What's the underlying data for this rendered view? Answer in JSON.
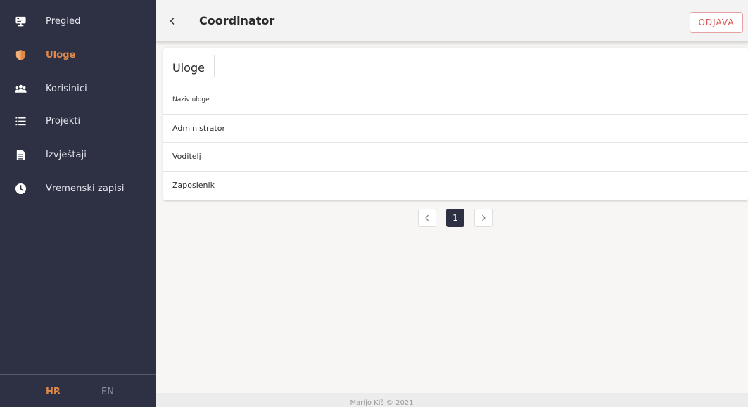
{
  "sidebar": {
    "items": [
      {
        "label": "Pregled",
        "icon": "monitor-icon"
      },
      {
        "label": "Uloge",
        "icon": "shield-icon",
        "active": true
      },
      {
        "label": "Korisinici",
        "icon": "users-icon"
      },
      {
        "label": "Projekti",
        "icon": "list-icon"
      },
      {
        "label": "Izvještaji",
        "icon": "report-icon"
      },
      {
        "label": "Vremenski zapisi",
        "icon": "clock-icon"
      }
    ],
    "languages": {
      "hr": "HR",
      "en": "EN"
    }
  },
  "header": {
    "back_icon": "chevron-left-icon",
    "title": "Coordinator",
    "logout_label": "ODJAVA"
  },
  "card": {
    "title": "Uloge",
    "column_header": "Naziv uloge",
    "rows": [
      "Administrator",
      "Voditelj",
      "Zaposlenik"
    ]
  },
  "pagination": {
    "prev_icon": "chevron-left-icon",
    "current": "1",
    "next_icon": "chevron-right-icon"
  },
  "footer": {
    "text": "Marijo Kiš © 2021"
  },
  "colors": {
    "sidebar_bg": "#2e3143",
    "accent": "#e08a4a",
    "logout": "#d9534f"
  }
}
